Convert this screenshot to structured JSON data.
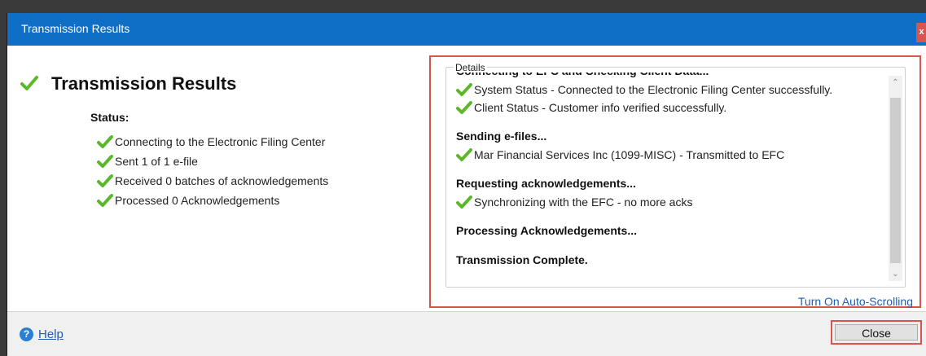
{
  "window": {
    "title": "Transmission Results",
    "close_glyph": "x"
  },
  "left": {
    "heading": "Transmission Results",
    "status_label": "Status:",
    "status_items": [
      "Connecting to the Electronic Filing Center",
      "Sent 1 of 1 e-file",
      "Received 0 batches of acknowledgements",
      "Processed 0 Acknowledgements"
    ]
  },
  "details": {
    "legend": "Details",
    "section_connect": "Connecting to EFC and Checking Client Data...",
    "system_status": "System Status - Connected to the Electronic Filing Center successfully.",
    "client_status": "Client Status - Customer info verified successfully.",
    "section_send": "Sending e-files...",
    "sent_file": "Mar Financial Services Inc (1099-MISC) - Transmitted to EFC",
    "section_request": "Requesting acknowledgements...",
    "sync": "Synchronizing with the EFC - no more acks",
    "section_process": "Processing Acknowledgements...",
    "section_complete": "Transmission Complete.",
    "autoscroll_link": "Turn On Auto-Scrolling"
  },
  "footer": {
    "help_label": "Help",
    "help_glyph": "?",
    "close_label": "Close"
  },
  "icons": {
    "check": "check-icon",
    "help": "help-icon"
  },
  "colors": {
    "titlebar": "#0f6fc6",
    "check": "#5cb82a",
    "highlight": "#d9534f",
    "link": "#1c5fb4"
  }
}
